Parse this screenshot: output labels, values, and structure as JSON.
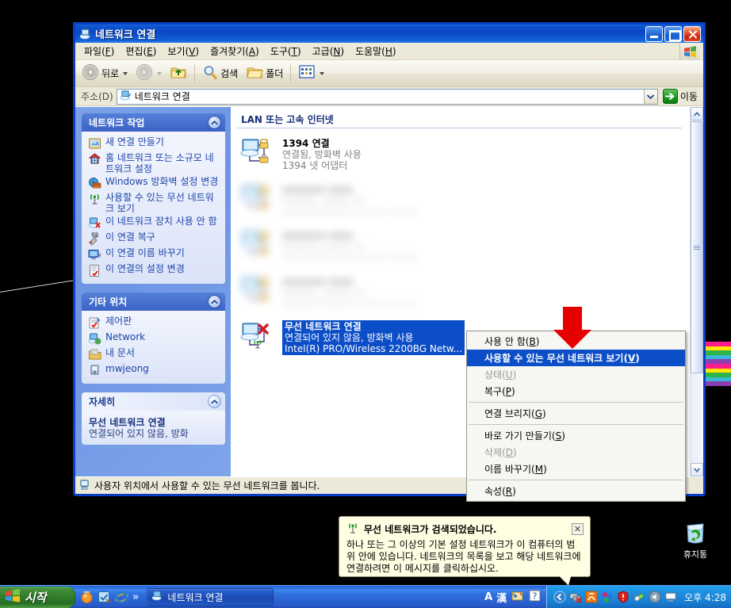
{
  "window": {
    "title": "네트워크 연결",
    "menu": [
      {
        "label": "파일(F)"
      },
      {
        "label": "편집(E)"
      },
      {
        "label": "보기(V)"
      },
      {
        "label": "즐겨찾기(A)"
      },
      {
        "label": "도구(T)"
      },
      {
        "label": "고급(N)"
      },
      {
        "label": "도움말(H)"
      }
    ],
    "toolbar": {
      "back": "뒤로",
      "search": "검색",
      "folders": "폴더"
    },
    "address": {
      "label": "주소(D)",
      "value": "네트워크 연결",
      "go": "이동"
    },
    "statusbar": "사용자 위치에서 사용할 수 있는 무선 네트워크를 봅니다."
  },
  "sidebar": {
    "tasks_panel": {
      "title": "네트워크 작업",
      "items": [
        {
          "label": "새 연결 만들기",
          "icon": "new-connection-icon"
        },
        {
          "label": "홈 네트워크 또는 소규모 네트워크 설정",
          "icon": "home-network-icon"
        },
        {
          "label": "Windows 방화벽 설정 변경",
          "icon": "firewall-icon"
        },
        {
          "label": "사용할 수 있는 무선 네트워크 보기",
          "icon": "wireless-icon"
        },
        {
          "label": "이 네트워크 장치 사용 안 함",
          "icon": "disable-device-icon"
        },
        {
          "label": "이 연결 복구",
          "icon": "repair-icon"
        },
        {
          "label": "이 연결 이름 바꾸기",
          "icon": "rename-icon"
        },
        {
          "label": "이 연결의 설정 변경",
          "icon": "settings-icon"
        }
      ]
    },
    "places_panel": {
      "title": "기타 위치",
      "items": [
        {
          "label": "제어판",
          "icon": "control-panel-icon"
        },
        {
          "label": "Network",
          "icon": "network-icon"
        },
        {
          "label": "내 문서",
          "icon": "my-documents-icon"
        },
        {
          "label": "mwjeong",
          "icon": "user-folder-icon"
        }
      ]
    },
    "details_panel": {
      "title": "자세히",
      "name": "무선 네트워크 연결",
      "sub": "연결되어 있지 않음, 방화"
    }
  },
  "filelist": {
    "group_header": "LAN 또는 고속 인터넷",
    "items": [
      {
        "name": "1394 연결",
        "status": "연결됨, 방화벽 사용",
        "device": "1394 넷 어댑터",
        "selected": false,
        "blurred": false
      },
      {
        "name": "",
        "status": "",
        "device": "",
        "selected": false,
        "blurred": true
      },
      {
        "name": "",
        "status": "",
        "device": "",
        "selected": false,
        "blurred": true
      },
      {
        "name": "",
        "status": "",
        "device": "",
        "selected": false,
        "blurred": true
      },
      {
        "name": "무선 네트워크 연결",
        "status": "연결되어 있지 않음, 방화벽 사용",
        "device": "Intel(R) PRO/Wireless 2200BG Netw...",
        "selected": true,
        "blurred": false
      }
    ]
  },
  "context_menu": {
    "items": [
      {
        "label": "사용 안 함(B)",
        "state": "normal"
      },
      {
        "label": "사용할 수 있는 무선 네트워크 보기(V)",
        "state": "highlighted"
      },
      {
        "label": "상태(U)",
        "state": "disabled"
      },
      {
        "label": "복구(P)",
        "state": "normal"
      },
      {
        "separator": true
      },
      {
        "label": "연결 브리지(G)",
        "state": "normal"
      },
      {
        "separator": true
      },
      {
        "label": "바로 가기 만들기(S)",
        "state": "normal"
      },
      {
        "label": "삭제(D)",
        "state": "disabled"
      },
      {
        "label": "이름 바꾸기(M)",
        "state": "normal"
      },
      {
        "separator": true
      },
      {
        "label": "속성(R)",
        "state": "normal"
      }
    ]
  },
  "balloon": {
    "title": "무선 네트워크가 검색되었습니다.",
    "body": "하나 또는 그 이상의 기본 설정 네트워크가 이 컴퓨터의 범위 안에 있습니다. 네트워크의 목록을 보고 해당 네트워크에 연결하려면 이 메시지를 클릭하십시오.",
    "close": "✕"
  },
  "desktop": {
    "recycle_bin": "휴지통",
    "flag_colors": [
      "#ff1b8d",
      "#ffe500",
      "#2fb44a",
      "#3ab7d6",
      "#8b3fb0"
    ]
  },
  "taskbar": {
    "start": "시작",
    "quick_more": "»",
    "task_item": "네트워크 연결",
    "ime_alpha": "A",
    "ime_hanja": "漢",
    "clock": "오후 4:28"
  },
  "colors": {
    "titlebar_blue": "#0b47c6",
    "selection_blue": "#0b4ec8",
    "sidebar_blue": "#7ba2e8",
    "link_blue": "#1d44a8",
    "balloon_bg": "#fffee3",
    "red_arrow": "#e60000"
  }
}
